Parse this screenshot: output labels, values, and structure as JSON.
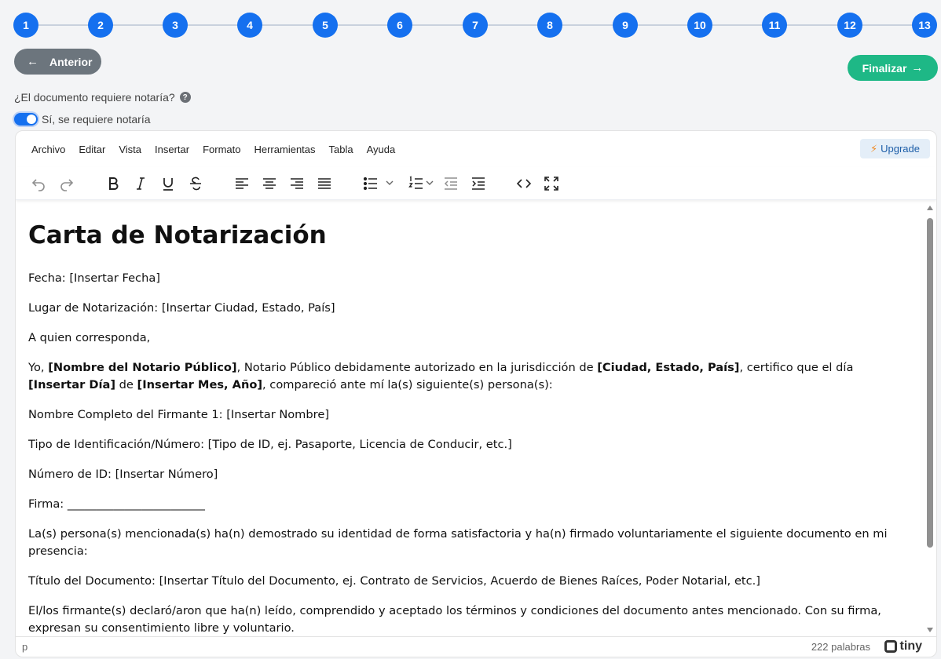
{
  "stepper": {
    "steps": [
      "1",
      "2",
      "3",
      "4",
      "5",
      "6",
      "7",
      "8",
      "9",
      "10",
      "11",
      "12",
      "13"
    ]
  },
  "nav": {
    "prev_label": "Anterior",
    "finish_label": "Finalizar"
  },
  "question": {
    "text": "¿El documento requiere notaría?",
    "help": "?"
  },
  "toggle": {
    "label": "Sí, se requiere notaría",
    "checked": true
  },
  "editor": {
    "menu": [
      "Archivo",
      "Editar",
      "Vista",
      "Insertar",
      "Formato",
      "Herramientas",
      "Tabla",
      "Ayuda"
    ],
    "upgrade_label": "Upgrade",
    "toolbar": [
      "undo-icon",
      "redo-icon",
      "bold-icon",
      "italic-icon",
      "underline-icon",
      "strikethrough-icon",
      "align-left-icon",
      "align-center-icon",
      "align-right-icon",
      "align-justify-icon",
      "bullet-list-icon",
      "numbered-list-icon",
      "outdent-icon",
      "indent-icon",
      "code-icon",
      "fullscreen-icon"
    ],
    "status_path": "p",
    "word_count": "222 palabras",
    "brand": "tiny"
  },
  "document": {
    "title": "Carta de Notarización",
    "p_fecha": "Fecha: [Insertar Fecha]",
    "p_lugar": "Lugar de Notarización: [Insertar Ciudad, Estado, País]",
    "p_saludo": "A quien corresponda,",
    "p_intro": {
      "t1": "Yo, ",
      "b1": "[Nombre del Notario Público]",
      "t2": ", Notario Público debidamente autorizado en la jurisdicción de ",
      "b2": "[Ciudad, Estado, País]",
      "t3": ", certifico que el día ",
      "b3": "[Insertar Día]",
      "t4": " de ",
      "b4": "[Insertar Mes, Año]",
      "t5": ", compareció ante mí la(s) siguiente(s) persona(s):"
    },
    "p_nombre": "Nombre Completo del Firmante 1: [Insertar Nombre]",
    "p_tipo_id": "Tipo de Identificación/Número: [Tipo de ID, ej. Pasaporte, Licencia de Conducir, etc.]",
    "p_numero_id": "Número de ID: [Insertar Número]",
    "p_firma": "Firma: ________________________",
    "p_identidad": "La(s) persona(s) mencionada(s) ha(n) demostrado su identidad de forma satisfactoria y ha(n) firmado voluntariamente el siguiente documento en mi presencia:",
    "p_titulo_doc": "Título del Documento: [Insertar Título del Documento, ej. Contrato de Servicios, Acuerdo de Bienes Raíces, Poder Notarial, etc.]",
    "p_declaracion": "El/los firmante(s) declaró/aron que ha(n) leído, comprendido y aceptado los términos y condiciones del documento antes mencionado. Con su firma, expresan su consentimiento libre y voluntario."
  },
  "colors": {
    "primary": "#1570ef",
    "success": "#1eb886",
    "secondary": "#6c757d"
  }
}
